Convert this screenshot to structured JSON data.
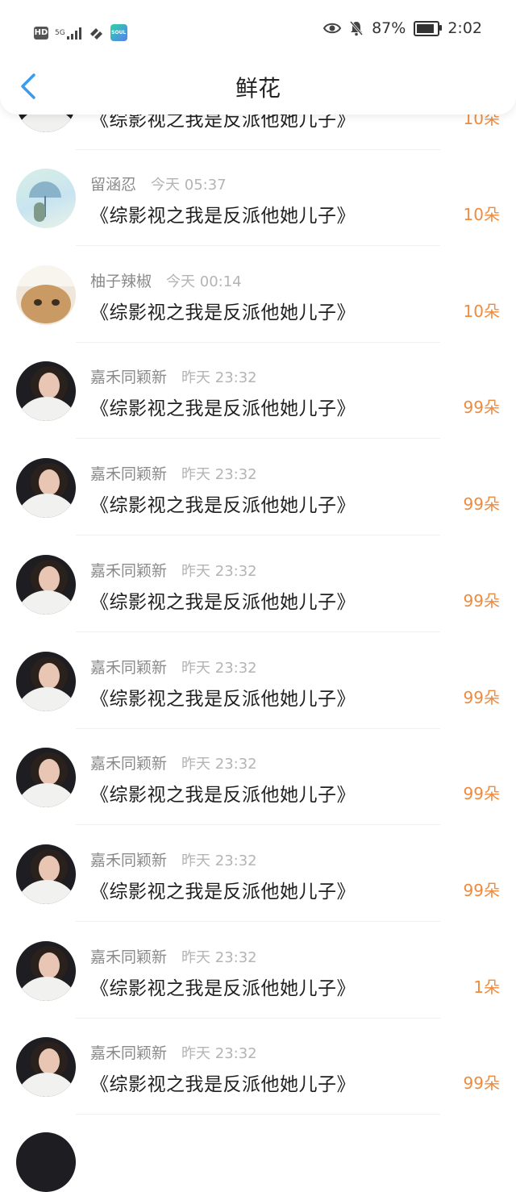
{
  "status_bar": {
    "hd_label": "HD",
    "network_label": "5G",
    "app_badge": "SOUL",
    "battery": "87%",
    "battery_level": 0.87,
    "time": "2:02"
  },
  "header": {
    "title": "鲜花"
  },
  "top_partial": {
    "title": "《综影视之我是反派他她儿子》",
    "count": "10朵"
  },
  "items": [
    {
      "name": "留涵忍",
      "time": "今天 05:37",
      "title": "《综影视之我是反派他她儿子》",
      "count": "10朵",
      "avatar": "umbrella"
    },
    {
      "name": "柚子辣椒",
      "time": "今天 00:14",
      "title": "《综影视之我是反派他她儿子》",
      "count": "10朵",
      "avatar": "cat"
    },
    {
      "name": "嘉禾同颖新",
      "time": "昨天 23:32",
      "title": "《综影视之我是反派他她儿子》",
      "count": "99朵",
      "avatar": "portrait"
    },
    {
      "name": "嘉禾同颖新",
      "time": "昨天 23:32",
      "title": "《综影视之我是反派他她儿子》",
      "count": "99朵",
      "avatar": "portrait"
    },
    {
      "name": "嘉禾同颖新",
      "time": "昨天 23:32",
      "title": "《综影视之我是反派他她儿子》",
      "count": "99朵",
      "avatar": "portrait"
    },
    {
      "name": "嘉禾同颖新",
      "time": "昨天 23:32",
      "title": "《综影视之我是反派他她儿子》",
      "count": "99朵",
      "avatar": "portrait"
    },
    {
      "name": "嘉禾同颖新",
      "time": "昨天 23:32",
      "title": "《综影视之我是反派他她儿子》",
      "count": "99朵",
      "avatar": "portrait"
    },
    {
      "name": "嘉禾同颖新",
      "time": "昨天 23:32",
      "title": "《综影视之我是反派他她儿子》",
      "count": "99朵",
      "avatar": "portrait"
    },
    {
      "name": "嘉禾同颖新",
      "time": "昨天 23:32",
      "title": "《综影视之我是反派他她儿子》",
      "count": "1朵",
      "avatar": "portrait"
    },
    {
      "name": "嘉禾同颖新",
      "time": "昨天 23:32",
      "title": "《综影视之我是反派他她儿子》",
      "count": "99朵",
      "avatar": "portrait"
    }
  ],
  "colors": {
    "accent": "#3a9bf0",
    "count": "#f08a3c"
  }
}
